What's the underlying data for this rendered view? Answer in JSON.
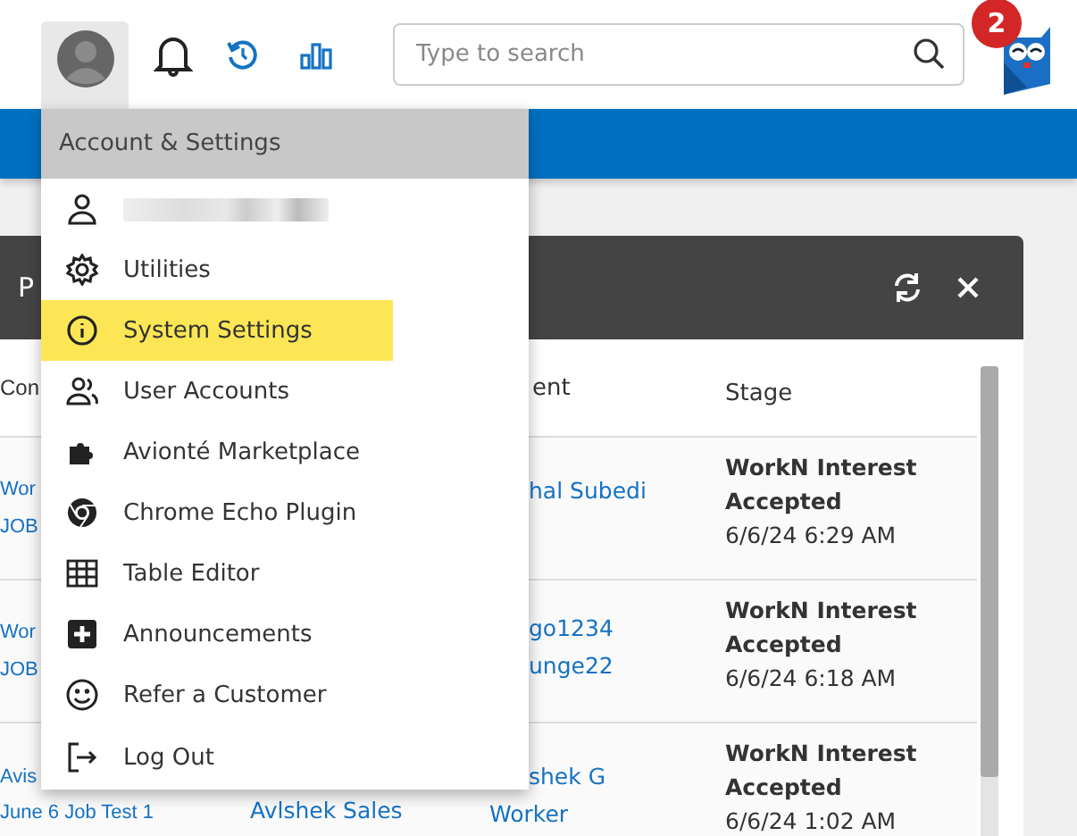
{
  "topbar": {
    "account_open": true,
    "search": {
      "placeholder": "Type to search"
    },
    "notification_count": "2"
  },
  "menu": {
    "title": "Account & Settings",
    "items": [
      {
        "kind": "user",
        "selected": false
      },
      {
        "kind": "gear",
        "label": "Utilities",
        "selected": false
      },
      {
        "kind": "info",
        "label": "System Settings",
        "selected": true
      },
      {
        "kind": "users",
        "label": "User Accounts",
        "selected": false
      },
      {
        "kind": "puzzle",
        "label": "Avionté Marketplace",
        "selected": false
      },
      {
        "kind": "chrome",
        "label": "Chrome Echo Plugin",
        "selected": false
      },
      {
        "kind": "table",
        "label": "Table Editor",
        "selected": false
      },
      {
        "kind": "plus",
        "label": "Announcements",
        "selected": false
      },
      {
        "kind": "smile",
        "label": "Refer a Customer",
        "selected": false
      },
      {
        "kind": "logout",
        "label": "Log Out",
        "selected": false
      }
    ]
  },
  "panel": {
    "title": "P",
    "columns": [
      "Con",
      "",
      "ent",
      "Stage"
    ],
    "rows": [
      {
        "column_1": [
          "Wor",
          "JOB"
        ],
        "column_2": [],
        "column_3": [
          {
            "text": "hal Subedi",
            "partial": true
          }
        ],
        "stage": "WorkN Interest Accepted",
        "time": "6/6/24 6:29 AM"
      },
      {
        "column_1": [
          "Wor",
          "JOB"
        ],
        "column_2": [],
        "column_3": [
          {
            "text": "go1234",
            "partial": true
          },
          {
            "text": "unge22",
            "partial": true
          }
        ],
        "stage": "WorkN Interest Accepted",
        "time": "6/6/24 6:18 AM"
      },
      {
        "column_1": [
          "Avis",
          "June 6 Job Test 1"
        ],
        "column_2": [
          "Avlshek Sales"
        ],
        "column_3": [
          {
            "text": "shek G",
            "partial": true
          },
          {
            "text": "Worker",
            "partial": false
          }
        ],
        "stage": "WorkN Interest Accepted",
        "time": "6/6/24 1:02 AM"
      }
    ]
  }
}
